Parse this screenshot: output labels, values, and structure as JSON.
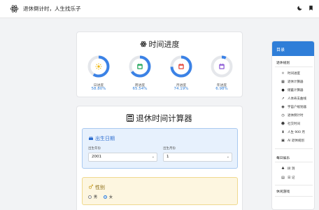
{
  "header": {
    "site_title": "退休倒计时，人生找乐子",
    "theme_icon": "moon-icon",
    "bookmark_icon": "bookmark-icon"
  },
  "progress": {
    "title": "时间进度",
    "title_icon": "atom-icon",
    "rings": [
      {
        "label": "日进度",
        "value": "58.80%",
        "fraction": 0.588,
        "color": "#3b82e6",
        "icon": "sun-icon"
      },
      {
        "label": "周进度",
        "value": "65.54%",
        "fraction": 0.6554,
        "color": "#3b82e6",
        "icon": "calendar-week-icon"
      },
      {
        "label": "月进度",
        "value": "74.19%",
        "fraction": 0.7419,
        "color": "#3b82e6",
        "icon": "calendar-month-icon"
      },
      {
        "label": "年进度",
        "value": "6.98%",
        "fraction": 0.0698,
        "color": "#3b82e6",
        "icon": "calendar-year-icon"
      }
    ]
  },
  "calculator": {
    "title": "退休时间计算器",
    "title_icon": "calculator-icon",
    "birth": {
      "heading": "出生日期",
      "year_label": "出生年份",
      "year_value": "2001",
      "month_label": "出生月份",
      "month_value": "1"
    },
    "gender": {
      "heading": "性别",
      "male": "男",
      "female": "女",
      "selected": "女"
    }
  },
  "sidebar": {
    "title": "目录",
    "sections": [
      {
        "label": "退休规划",
        "items": [
          {
            "label": "时间进度",
            "icon": "atom-icon"
          },
          {
            "label": "退休计算器",
            "icon": "calculator-icon"
          },
          {
            "label": "储蓄计算器",
            "icon": "piggy-bank-icon"
          },
          {
            "label": "人体寿支曲线",
            "icon": "chart-icon"
          },
          {
            "label": "宇宙户规划器",
            "icon": "globe-icon"
          },
          {
            "label": "退休倒计时",
            "icon": "clock-icon"
          },
          {
            "label": "社交时间",
            "icon": "users-icon"
          },
          {
            "label": "人生 900 月",
            "icon": "hourglass-icon"
          },
          {
            "label": "AI 退休规划",
            "icon": "robot-icon"
          }
        ]
      },
      {
        "label": "每日娱乐",
        "items": [
          {
            "label": "树 洞",
            "icon": "tree-icon"
          },
          {
            "label": "日 记",
            "icon": "book-icon"
          }
        ]
      },
      {
        "label": "休闲游戏",
        "items": []
      }
    ]
  }
}
